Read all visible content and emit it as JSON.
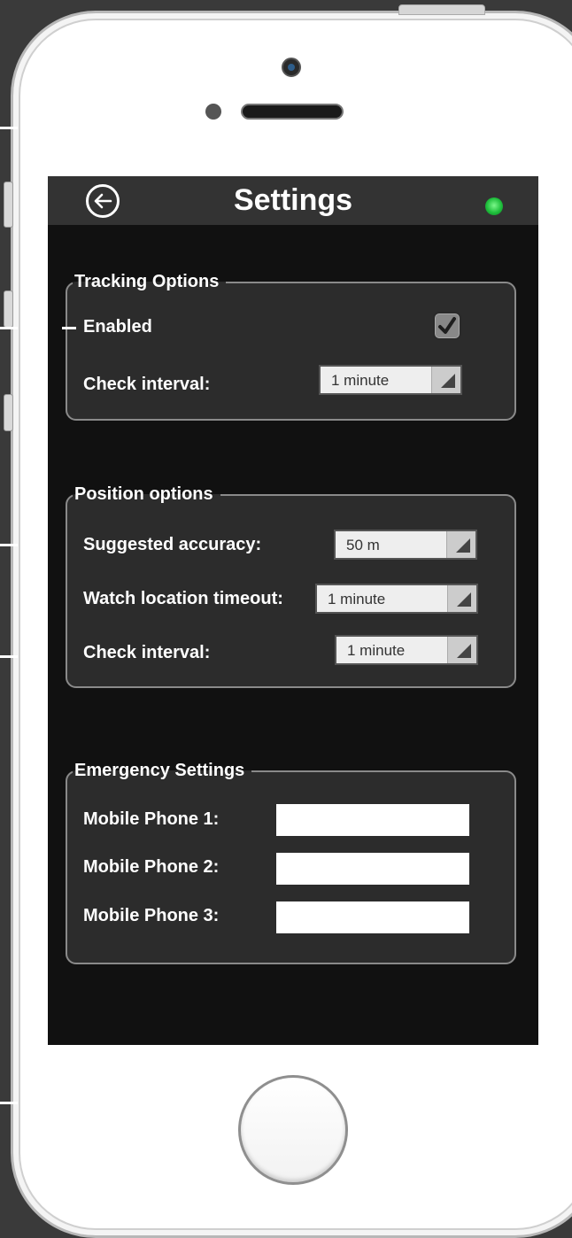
{
  "header": {
    "title": "Settings",
    "back_icon": "back-arrow-circle-icon",
    "status_color": "#22c23f"
  },
  "tracking": {
    "legend": "Tracking Options",
    "enabled_label": "Enabled",
    "enabled_checked": true,
    "interval_label": "Check interval:",
    "interval_value": "1 minute"
  },
  "position": {
    "legend": "Position options",
    "accuracy_label": "Suggested accuracy:",
    "accuracy_value": "50 m",
    "timeout_label": "Watch location timeout:",
    "timeout_value": "1 minute",
    "interval_label": "Check interval:",
    "interval_value": "1 minute"
  },
  "emergency": {
    "legend": "Emergency Settings",
    "phones": [
      {
        "label": "Mobile Phone 1:",
        "value": ""
      },
      {
        "label": "Mobile Phone 2:",
        "value": ""
      },
      {
        "label": "Mobile Phone 3:",
        "value": ""
      }
    ]
  }
}
